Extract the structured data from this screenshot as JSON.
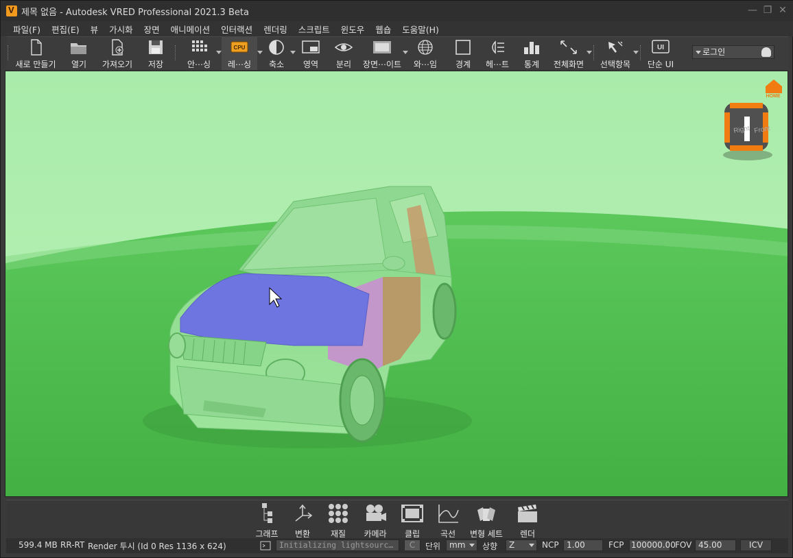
{
  "window": {
    "title": "제목 없음 - Autodesk VRED Professional 2021.3 Beta",
    "controls": [
      "—",
      "❐",
      "✕"
    ]
  },
  "menu": [
    "파일(F)",
    "편집(E)",
    "뷰",
    "가시화",
    "장면",
    "애니메이션",
    "인터랙션",
    "렌더링",
    "스크립트",
    "윈도우",
    "웹숍",
    "도움말(H)"
  ],
  "toolbar": {
    "new": "새로 만들기",
    "open": "열기",
    "import": "가져오기",
    "save": "저장",
    "antialiasing": "안⋯싱",
    "render_mode": "레⋯싱",
    "render_mode_badge": "CPU",
    "scale": "축소",
    "region": "영역",
    "isolate": "분리",
    "scene": "장면⋯이트",
    "wire": "와⋯임",
    "bounds": "경계",
    "headlight": "헤⋯트",
    "stats": "통계",
    "fullscreen": "전체화면",
    "selection": "선택항목",
    "simple_ui": "단순 UI",
    "simple_ui_badge": "UI",
    "login": "로그인"
  },
  "viewport": {
    "home_label": "HOME",
    "cube_right": "Right",
    "cube_front": "Front"
  },
  "bottom_tools": {
    "graph": "그래프",
    "transform": "변환",
    "material": "재질",
    "camera": "카메라",
    "clip": "클립",
    "curve": "곡선",
    "variant_set": "변형 세트",
    "render": "렌더"
  },
  "status": {
    "memory": "599.4 MB",
    "renderer": "RR-RT",
    "render_info": "Render 투시 (Id 0 Res 1136 x 624)",
    "message": "Initializing lightsourc…",
    "c_button": "C",
    "unit_label": "단위",
    "unit_value": "mm",
    "up_label": "상향",
    "up_value": "Z",
    "ncp_label": "NCP",
    "ncp_value": "1.00",
    "fcp_label": "FCP",
    "fcp_value": "100000.00",
    "fov_label": "FOV",
    "fov_value": "45.00",
    "icv_button": "ICV"
  }
}
